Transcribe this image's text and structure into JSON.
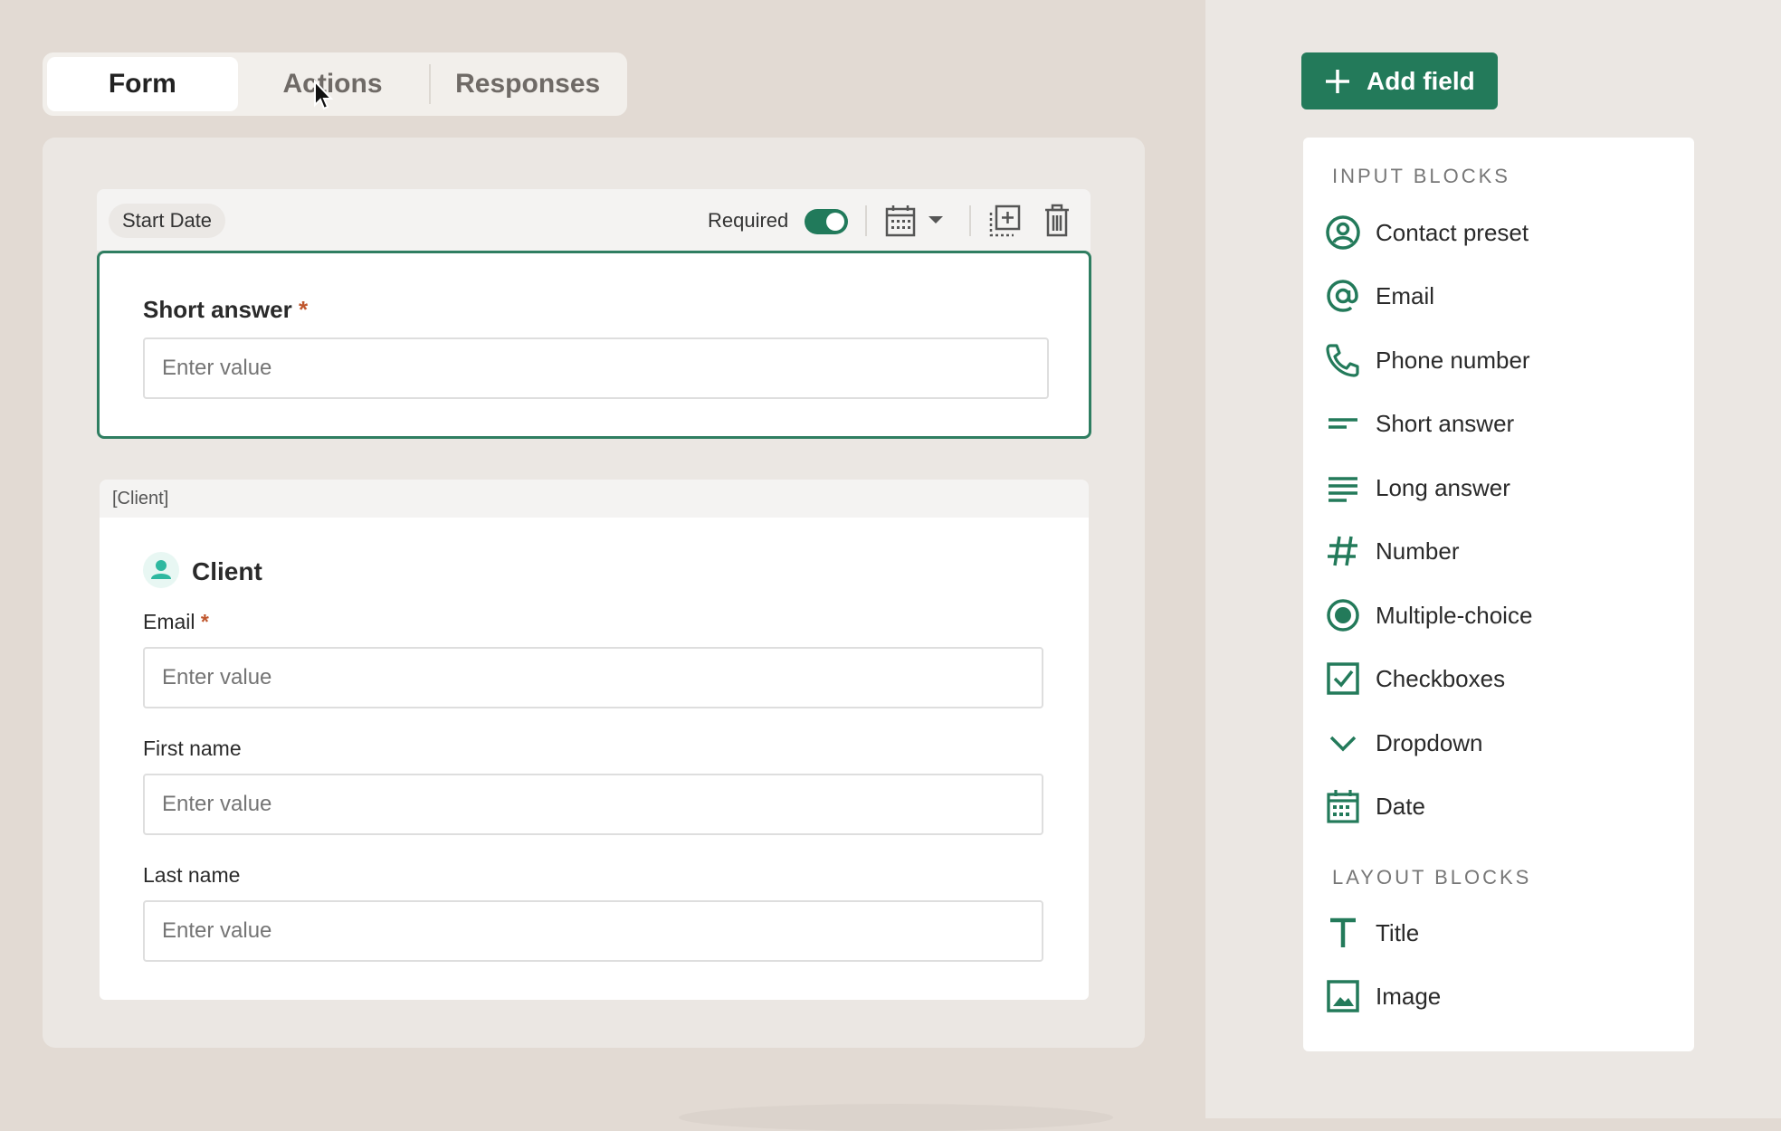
{
  "tabs": [
    {
      "label": "Form",
      "active": true
    },
    {
      "label": "Actions",
      "active": false
    },
    {
      "label": "Responses",
      "active": false
    }
  ],
  "block1": {
    "chip": "Start Date",
    "required_label": "Required",
    "required_on": true,
    "field_title": "Short answer",
    "required_marker": "*",
    "placeholder": "Enter value"
  },
  "block2": {
    "tag": "[Client]",
    "title": "Client",
    "fields": [
      {
        "label": "Email",
        "required": true,
        "placeholder": "Enter value"
      },
      {
        "label": "First name",
        "required": false,
        "placeholder": "Enter value"
      },
      {
        "label": "Last name",
        "required": false,
        "placeholder": "Enter value"
      }
    ]
  },
  "sidebar": {
    "add_button": "Add field",
    "input_section": "INPUT BLOCKS",
    "input_items": [
      {
        "label": "Contact preset",
        "icon": "contact-icon"
      },
      {
        "label": "Email",
        "icon": "at-icon"
      },
      {
        "label": "Phone number",
        "icon": "phone-icon"
      },
      {
        "label": "Short answer",
        "icon": "short-text-icon"
      },
      {
        "label": "Long answer",
        "icon": "long-text-icon"
      },
      {
        "label": "Number",
        "icon": "hash-icon"
      },
      {
        "label": "Multiple-choice",
        "icon": "radio-icon"
      },
      {
        "label": "Checkboxes",
        "icon": "checkbox-icon"
      },
      {
        "label": "Dropdown",
        "icon": "chevron-down-icon"
      },
      {
        "label": "Date",
        "icon": "calendar-icon"
      }
    ],
    "layout_section": "LAYOUT BLOCKS",
    "layout_items": [
      {
        "label": "Title",
        "icon": "title-icon"
      },
      {
        "label": "Image",
        "icon": "image-icon"
      }
    ]
  },
  "colors": {
    "accent": "#237a5a",
    "required_star": "#c0572e",
    "background": "#e2dad3"
  }
}
